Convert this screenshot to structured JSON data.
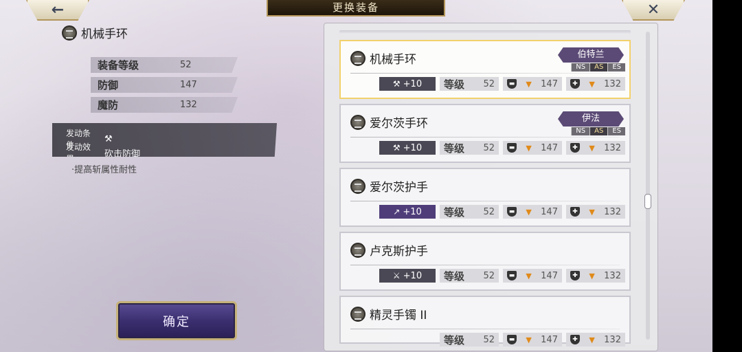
{
  "header": {
    "title": "更换装备",
    "back_icon": "←",
    "close_icon": "✕"
  },
  "left": {
    "item_name": "机械手环",
    "stats": [
      {
        "label": "装备等级",
        "value": "52"
      },
      {
        "label": "防御",
        "value": "147"
      },
      {
        "label": "魔防",
        "value": "132"
      }
    ],
    "trigger": {
      "condition_label": "发动条件",
      "effect_label": "发动效果",
      "effect_value": "砍击防御"
    },
    "note": "·提高斩属性耐性",
    "confirm_label": "确定"
  },
  "list": {
    "level_label": "等级",
    "items": [
      {
        "name": "机械手环",
        "owner": "伯特兰",
        "ns": [
          "NS",
          "AS",
          "ES"
        ],
        "active": "AS",
        "upgrade": "+10",
        "icon": "wrench",
        "level": "52",
        "def": "147",
        "mdef": "132",
        "selected": true
      },
      {
        "name": "爱尔茨手环",
        "owner": "伊法",
        "ns": [
          "NS",
          "AS",
          "ES"
        ],
        "active": "AS",
        "upgrade": "+10",
        "icon": "wrench",
        "level": "52",
        "def": "147",
        "mdef": "132",
        "selected": false
      },
      {
        "name": "爱尔茨护手",
        "owner": "",
        "upgrade": "+10",
        "icon": "arrow",
        "level": "52",
        "def": "147",
        "mdef": "132",
        "selected": false
      },
      {
        "name": "卢克斯护手",
        "owner": "",
        "upgrade": "+10",
        "icon": "sword",
        "level": "52",
        "def": "147",
        "mdef": "132",
        "selected": false
      },
      {
        "name": "精灵手镯 II",
        "owner": "",
        "upgrade": "",
        "icon": "",
        "level": "52",
        "def": "147",
        "mdef": "132",
        "selected": false
      }
    ]
  },
  "colors": {
    "accent_gold": "#b29559",
    "owner_purple": "#5b4a76",
    "arrow_orange": "#e08a1a"
  }
}
